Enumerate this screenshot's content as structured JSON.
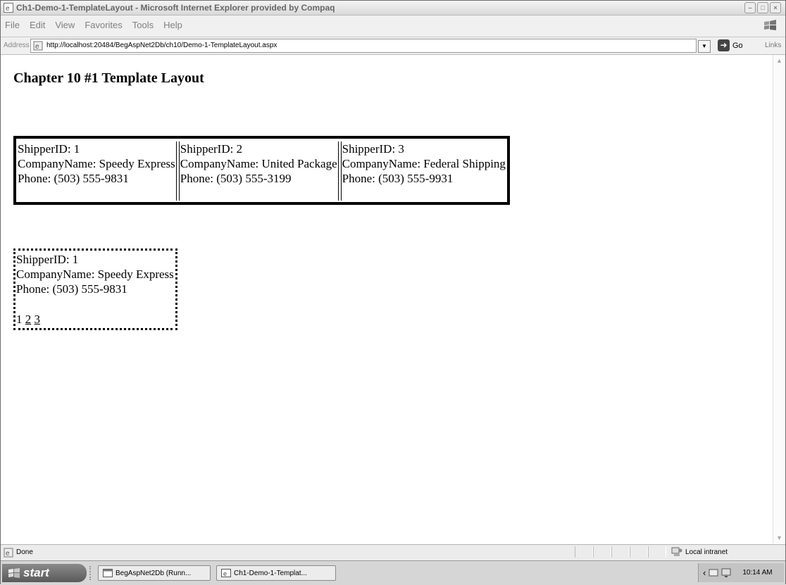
{
  "window": {
    "title": "Ch1-Demo-1-TemplateLayout - Microsoft Internet Explorer provided by Compaq"
  },
  "menu": {
    "items": [
      "File",
      "Edit",
      "View",
      "Favorites",
      "Tools",
      "Help"
    ]
  },
  "address": {
    "label": "Address",
    "url": "http://localhost:20484/BegAspNet2Db/ch10/Demo-1-TemplateLayout.aspx",
    "go_label": "Go",
    "links_label": "Links"
  },
  "page": {
    "title": "Chapter 10 #1 Template Layout",
    "datalist": [
      {
        "id": "ShipperID: 1",
        "company": "CompanyName: Speedy Express",
        "phone": "Phone: (503) 555-9831"
      },
      {
        "id": "ShipperID: 2",
        "company": "CompanyName: United Package",
        "phone": "Phone: (503) 555-3199"
      },
      {
        "id": "ShipperID: 3",
        "company": "CompanyName: Federal Shipping",
        "phone": "Phone: (503) 555-9931"
      }
    ],
    "formview": {
      "id": "ShipperID: 1",
      "company": "CompanyName: Speedy Express",
      "phone": "Phone: (503) 555-9831",
      "pager": {
        "current": "1",
        "links": [
          "2",
          "3"
        ]
      }
    }
  },
  "status": {
    "text": "Done",
    "zone": "Local intranet"
  },
  "taskbar": {
    "start_label": "start",
    "tasks": [
      "BegAspNet2Db (Runn...",
      "Ch1-Demo-1-Templat..."
    ],
    "clock": "10:14 AM"
  }
}
